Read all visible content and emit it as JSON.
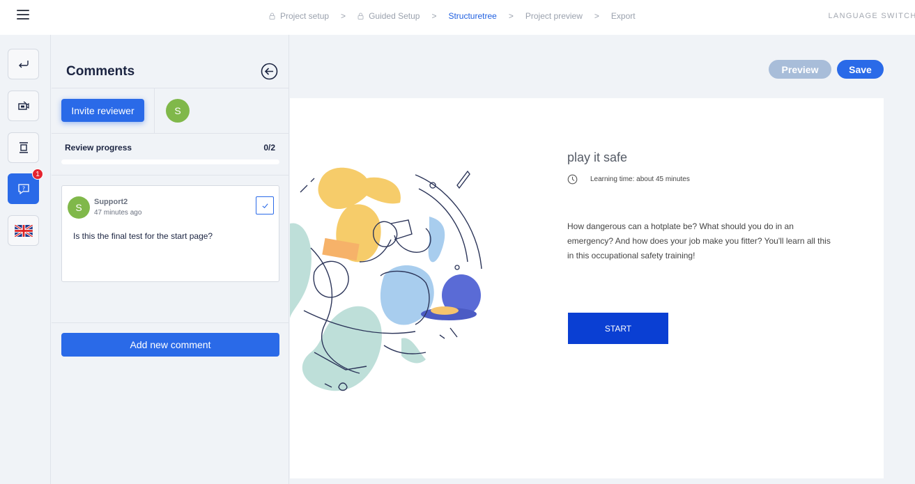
{
  "topbar": {
    "breadcrumbs": [
      {
        "label": "Project setup",
        "locked": true,
        "active": false
      },
      {
        "label": "Guided Setup",
        "locked": true,
        "active": false
      },
      {
        "label": "Structuretree",
        "locked": false,
        "active": true
      },
      {
        "label": "Project preview",
        "locked": false,
        "active": false
      },
      {
        "label": "Export",
        "locked": false,
        "active": false
      }
    ],
    "separator": ">",
    "language_switch": "LANGUAGE SWITCH?"
  },
  "rail": {
    "items": [
      "back-arrow-icon",
      "media-icon",
      "structure-icon",
      "comments-icon",
      "uk-flag-icon"
    ],
    "comments_badge": "1"
  },
  "comments_panel": {
    "title": "Comments",
    "invite_label": "Invite reviewer",
    "reviewer_initial": "S",
    "review_progress_label": "Review progress",
    "review_progress_count": "0/2",
    "review_progress_fraction": 0,
    "comment": {
      "author_initial": "S",
      "author": "Support2",
      "time": "47 minutes ago",
      "text": "Is this the final test for the start page?"
    },
    "add_comment_label": "Add new comment"
  },
  "preview": {
    "preview_label": "Preview",
    "save_label": "Save",
    "title": "play it safe",
    "learning_time": "Learning time: about 45 minutes",
    "description": "How dangerous can a hotplate be? What should you do in an emergency? And how does your job make you fitter? You'll learn all this in this occupational safety training!",
    "start_label": "START"
  },
  "colors": {
    "accent": "#2a6ae8",
    "start_button": "#0a3fd3",
    "avatar": "#80b84a",
    "badge": "#e5242f"
  }
}
